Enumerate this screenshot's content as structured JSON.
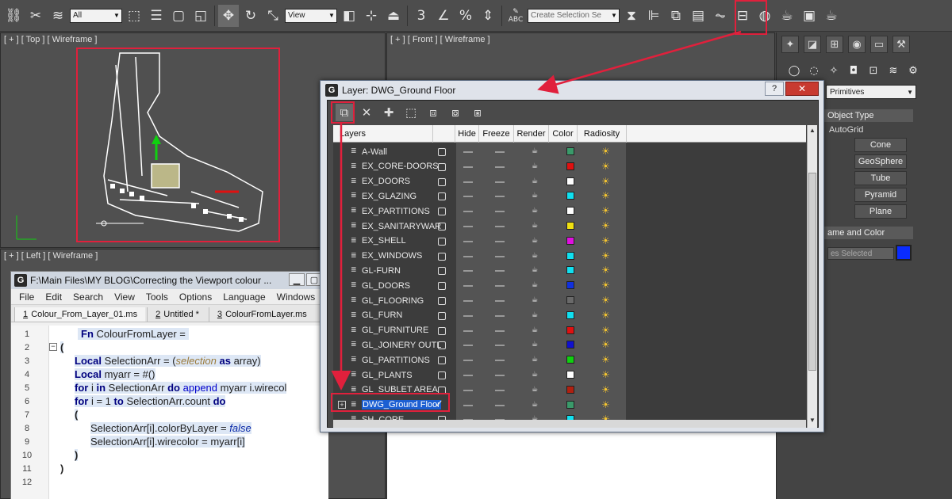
{
  "toolbar": {
    "selection_filter": "All",
    "reference_coord": "View",
    "named_selection_placeholder": "Create Selection Se",
    "icons": [
      "link-icon",
      "unlink-icon",
      "bind-space-warp-icon",
      "select-object-icon",
      "select-by-name-icon",
      "rect-selection-icon",
      "window-crossing-icon",
      "select-move-icon",
      "select-rotate-icon",
      "select-scale-icon",
      "use-pivot-icon",
      "select-manipulate-icon",
      "keyboard-shortcut-icon",
      "snap-3d-icon",
      "angle-snap-icon",
      "percent-snap-icon",
      "spinner-snap-icon",
      "edit-named-selection-icon",
      "mirror-icon",
      "align-icon",
      "layer-manager-icon",
      "scene-explorer-icon",
      "curve-editor-icon",
      "schematic-view-icon",
      "material-editor-icon",
      "render-setup-icon",
      "render-frame-icon",
      "render-icon"
    ],
    "labels": {
      "snap_3": "3",
      "percent": "%",
      "abc": "ABC"
    }
  },
  "viewports": {
    "top_label": "[ + ] [ Top ] [ Wireframe ]",
    "front_label": "[ + ] [ Front ] [ Wireframe ]",
    "left_label": "[ + ] [ Left ] [ Wireframe ]"
  },
  "command_panel": {
    "dropdown": "Primitives",
    "object_type_title": "Object Type",
    "autogrid": "AutoGrid",
    "buttons": [
      "Cone",
      "GeoSphere",
      "Tube",
      "Pyramid",
      "Plane"
    ],
    "name_color_title": "ame and Color",
    "name_field": "es Selected",
    "swatch_color": "#0a2cff"
  },
  "editor": {
    "title": "F:\\Main Files\\MY BLOG\\Correcting the Viewport colour ...",
    "menu": [
      "File",
      "Edit",
      "Search",
      "View",
      "Tools",
      "Options",
      "Language",
      "Windows"
    ],
    "tabs": [
      {
        "num": "1",
        "name": "Colour_From_Layer_01.ms"
      },
      {
        "num": "2",
        "name": "Untitled *"
      },
      {
        "num": "3",
        "name": "ColourFromLayer.ms"
      }
    ],
    "line_numbers": [
      "1",
      "2",
      "3",
      "4",
      "5",
      "6",
      "7",
      "8",
      "9",
      "10",
      "11",
      "12"
    ],
    "code": {
      "l1_fn": "Fn",
      "l1_name": "ColourFromLayer =",
      "l2": "(",
      "l3_kw": "Local",
      "l3_a": "SelectionArr = (",
      "l3_sel": "selection",
      "l3_as": "as",
      "l3_b": "array)",
      "l4_kw": "Local",
      "l4_a": "myarr = #()",
      "l5_for": "for",
      "l5_a": "i",
      "l5_in": "in",
      "l5_b": "SelectionArr",
      "l5_do": "do",
      "l5_c": "append",
      "l5_d": "myarr i.wirecol",
      "l6_for": "for",
      "l6_a": "i = 1",
      "l6_to": "to",
      "l6_b": "SelectionArr.count",
      "l6_do": "do",
      "l7": "(",
      "l8_a": "SelectionArr[i].colorByLayer =",
      "l8_false": "false",
      "l9": "SelectionArr[i].wirecolor = myarr[i]",
      "l10": ")",
      "l11": ")"
    }
  },
  "layer_dialog": {
    "title": "Layer: DWG_Ground Floor",
    "help": "?",
    "close": "✕",
    "columns": [
      "Layers",
      "Hide",
      "Freeze",
      "Render",
      "Color",
      "Radiosity"
    ],
    "layers": [
      {
        "name": "A-Wall",
        "color": "#3a9a6a"
      },
      {
        "name": "EX_CORE-DOORS",
        "color": "#e01010"
      },
      {
        "name": "EX_DOORS",
        "color": "#ffffff"
      },
      {
        "name": "EX_GLAZING",
        "color": "#10e0f0"
      },
      {
        "name": "EX_PARTITIONS",
        "color": "#ffffff"
      },
      {
        "name": "EX_SANITARYWARE",
        "color": "#f0e010"
      },
      {
        "name": "EX_SHELL",
        "color": "#e010e0"
      },
      {
        "name": "EX_WINDOWS",
        "color": "#10e0f0"
      },
      {
        "name": "GL-FURN",
        "color": "#10e0f0"
      },
      {
        "name": "GL_DOORS",
        "color": "#1030e0"
      },
      {
        "name": "GL_FLOORING",
        "color": "#6a6a6a"
      },
      {
        "name": "GL_FURN",
        "color": "#10e0f0"
      },
      {
        "name": "GL_FURNITURE",
        "color": "#e01010"
      },
      {
        "name": "GL_JOINERY OUTLINE",
        "color": "#1010d0"
      },
      {
        "name": "GL_PARTITIONS",
        "color": "#10d010"
      },
      {
        "name": "GL_PLANTS",
        "color": "#ffffff"
      },
      {
        "name": "GL_SUBLET AREA",
        "color": "#b02010"
      },
      {
        "name": "DWG_Ground Floor",
        "color": "#3a9a6a",
        "current": "✓"
      },
      {
        "name": "SH_CORE",
        "color": "#10e0f0"
      }
    ]
  }
}
